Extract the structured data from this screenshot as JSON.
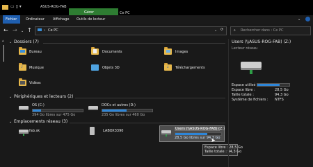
{
  "window": {
    "title": "ASUS-ROG-FAB",
    "context_tab": "Gérer",
    "location_title": "Ce PC"
  },
  "ribbon": {
    "tabs": [
      "Fichier",
      "Ordinateur",
      "Affichage",
      "Outils de lecteur"
    ]
  },
  "address": {
    "path": "Ce PC",
    "search_placeholder": "Rechercher dans : Ce PC"
  },
  "sections": {
    "folders": "Dossiers (7)",
    "drives": "Périphériques et lecteurs (2)",
    "network": "Emplacements réseau (3)"
  },
  "folders": [
    {
      "label": "Bureau",
      "icon": "desktop-folder-icon"
    },
    {
      "label": "Documents",
      "icon": "documents-folder-icon"
    },
    {
      "label": "Images",
      "icon": "pictures-folder-icon"
    },
    {
      "label": "Musique",
      "icon": "music-folder-icon"
    },
    {
      "label": "Objets 3D",
      "icon": "3d-objects-folder-icon"
    },
    {
      "label": "Téléchargements",
      "icon": "downloads-folder-icon"
    },
    {
      "label": "Vidéos",
      "icon": "videos-folder-icon"
    }
  ],
  "drives": [
    {
      "label": "OS (C:)",
      "free": "394 Go libres sur 475 Go",
      "used_fraction": 0.17
    },
    {
      "label": "DOCs et autres (D:)",
      "free": "235 Go libres sur 460 Go",
      "used_fraction": 0.49
    }
  ],
  "network": [
    {
      "label": "fab.sk",
      "icon": "network-drive-icon"
    },
    {
      "label": "LABOX3390",
      "icon": "network-device-icon"
    },
    {
      "label": "Users (\\\\ASUS-ROG-FAB) (Z:)",
      "free": "28,5 Go libres sur 94,3 Go",
      "used_fraction": 0.7
    }
  ],
  "details": {
    "title": "Users (\\\\ASUS-ROG-FAB) (Z:)",
    "subtitle": "Lecteur réseau",
    "used_label": "Espace utilisé :",
    "free_label": "Espace libre :",
    "free_value": "28,5 Go",
    "total_label": "Taille totale :",
    "total_value": "94,3 Go",
    "fs_label": "Système de fichiers :",
    "fs_value": "NTFS"
  },
  "tooltip": {
    "line1": "Espace libre : 28,5 Go",
    "line2": "Taille totale : 94,3 Go"
  },
  "colors": {
    "accent": "#2e86d8",
    "context_tab": "#2e7d32",
    "folder": "#e6b84c"
  }
}
